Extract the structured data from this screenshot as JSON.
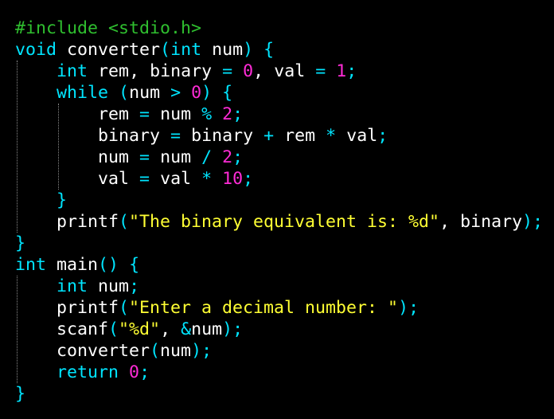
{
  "editor": {
    "colors": {
      "background": "#000000",
      "keyword": "#00e5ff",
      "type": "#00e5ff",
      "identifier": "#ffffff",
      "operator": "#00e5ff",
      "punctuation": "#ffffff",
      "number": "#ff2bd6",
      "string": "#ffff33",
      "preprocessor": "#2fbf2f",
      "indent_guide": "#8a8a8a"
    },
    "lines": [
      [
        {
          "t": "pre",
          "v": "#include <stdio.h>"
        }
      ],
      [
        {
          "t": "type",
          "v": "void"
        },
        {
          "t": "ws",
          "v": " "
        },
        {
          "t": "ident",
          "v": "converter"
        },
        {
          "t": "op",
          "v": "("
        },
        {
          "t": "type",
          "v": "int"
        },
        {
          "t": "ws",
          "v": " "
        },
        {
          "t": "ident",
          "v": "num"
        },
        {
          "t": "op",
          "v": ")"
        },
        {
          "t": "ws",
          "v": " "
        },
        {
          "t": "op",
          "v": "{"
        }
      ],
      [
        {
          "t": "ws",
          "v": "    "
        },
        {
          "t": "type",
          "v": "int"
        },
        {
          "t": "ws",
          "v": " "
        },
        {
          "t": "ident",
          "v": "rem"
        },
        {
          "t": "punct",
          "v": ","
        },
        {
          "t": "ws",
          "v": " "
        },
        {
          "t": "ident",
          "v": "binary"
        },
        {
          "t": "ws",
          "v": " "
        },
        {
          "t": "op",
          "v": "="
        },
        {
          "t": "ws",
          "v": " "
        },
        {
          "t": "number",
          "v": "0"
        },
        {
          "t": "punct",
          "v": ","
        },
        {
          "t": "ws",
          "v": " "
        },
        {
          "t": "ident",
          "v": "val"
        },
        {
          "t": "ws",
          "v": " "
        },
        {
          "t": "op",
          "v": "="
        },
        {
          "t": "ws",
          "v": " "
        },
        {
          "t": "number",
          "v": "1"
        },
        {
          "t": "op",
          "v": ";"
        }
      ],
      [
        {
          "t": "ws",
          "v": "    "
        },
        {
          "t": "keyword",
          "v": "while"
        },
        {
          "t": "ws",
          "v": " "
        },
        {
          "t": "op",
          "v": "("
        },
        {
          "t": "ident",
          "v": "num"
        },
        {
          "t": "ws",
          "v": " "
        },
        {
          "t": "op",
          "v": ">"
        },
        {
          "t": "ws",
          "v": " "
        },
        {
          "t": "number",
          "v": "0"
        },
        {
          "t": "op",
          "v": ")"
        },
        {
          "t": "ws",
          "v": " "
        },
        {
          "t": "op",
          "v": "{"
        }
      ],
      [
        {
          "t": "ws",
          "v": "        "
        },
        {
          "t": "ident",
          "v": "rem"
        },
        {
          "t": "ws",
          "v": " "
        },
        {
          "t": "op",
          "v": "="
        },
        {
          "t": "ws",
          "v": " "
        },
        {
          "t": "ident",
          "v": "num"
        },
        {
          "t": "ws",
          "v": " "
        },
        {
          "t": "op",
          "v": "%"
        },
        {
          "t": "ws",
          "v": " "
        },
        {
          "t": "number",
          "v": "2"
        },
        {
          "t": "op",
          "v": ";"
        }
      ],
      [
        {
          "t": "ws",
          "v": "        "
        },
        {
          "t": "ident",
          "v": "binary"
        },
        {
          "t": "ws",
          "v": " "
        },
        {
          "t": "op",
          "v": "="
        },
        {
          "t": "ws",
          "v": " "
        },
        {
          "t": "ident",
          "v": "binary"
        },
        {
          "t": "ws",
          "v": " "
        },
        {
          "t": "op",
          "v": "+"
        },
        {
          "t": "ws",
          "v": " "
        },
        {
          "t": "ident",
          "v": "rem"
        },
        {
          "t": "ws",
          "v": " "
        },
        {
          "t": "op",
          "v": "*"
        },
        {
          "t": "ws",
          "v": " "
        },
        {
          "t": "ident",
          "v": "val"
        },
        {
          "t": "op",
          "v": ";"
        }
      ],
      [
        {
          "t": "ws",
          "v": "        "
        },
        {
          "t": "ident",
          "v": "num"
        },
        {
          "t": "ws",
          "v": " "
        },
        {
          "t": "op",
          "v": "="
        },
        {
          "t": "ws",
          "v": " "
        },
        {
          "t": "ident",
          "v": "num"
        },
        {
          "t": "ws",
          "v": " "
        },
        {
          "t": "op",
          "v": "/"
        },
        {
          "t": "ws",
          "v": " "
        },
        {
          "t": "number",
          "v": "2"
        },
        {
          "t": "op",
          "v": ";"
        }
      ],
      [
        {
          "t": "ws",
          "v": "        "
        },
        {
          "t": "ident",
          "v": "val"
        },
        {
          "t": "ws",
          "v": " "
        },
        {
          "t": "op",
          "v": "="
        },
        {
          "t": "ws",
          "v": " "
        },
        {
          "t": "ident",
          "v": "val"
        },
        {
          "t": "ws",
          "v": " "
        },
        {
          "t": "op",
          "v": "*"
        },
        {
          "t": "ws",
          "v": " "
        },
        {
          "t": "number",
          "v": "10"
        },
        {
          "t": "op",
          "v": ";"
        }
      ],
      [
        {
          "t": "ws",
          "v": "    "
        },
        {
          "t": "op",
          "v": "}"
        }
      ],
      [
        {
          "t": "ws",
          "v": "    "
        },
        {
          "t": "ident",
          "v": "printf"
        },
        {
          "t": "op",
          "v": "("
        },
        {
          "t": "string",
          "v": "\"The binary equivalent is: %d\""
        },
        {
          "t": "punct",
          "v": ","
        },
        {
          "t": "ws",
          "v": " "
        },
        {
          "t": "ident",
          "v": "binary"
        },
        {
          "t": "op",
          "v": ")"
        },
        {
          "t": "op",
          "v": ";"
        }
      ],
      [
        {
          "t": "op",
          "v": "}"
        }
      ],
      [
        {
          "t": "type",
          "v": "int"
        },
        {
          "t": "ws",
          "v": " "
        },
        {
          "t": "ident",
          "v": "main"
        },
        {
          "t": "op",
          "v": "()"
        },
        {
          "t": "ws",
          "v": " "
        },
        {
          "t": "op",
          "v": "{"
        }
      ],
      [
        {
          "t": "ws",
          "v": "    "
        },
        {
          "t": "type",
          "v": "int"
        },
        {
          "t": "ws",
          "v": " "
        },
        {
          "t": "ident",
          "v": "num"
        },
        {
          "t": "op",
          "v": ";"
        }
      ],
      [
        {
          "t": "ws",
          "v": "    "
        },
        {
          "t": "ident",
          "v": "printf"
        },
        {
          "t": "op",
          "v": "("
        },
        {
          "t": "string",
          "v": "\"Enter a decimal number: \""
        },
        {
          "t": "op",
          "v": ")"
        },
        {
          "t": "op",
          "v": ";"
        }
      ],
      [
        {
          "t": "ws",
          "v": "    "
        },
        {
          "t": "ident",
          "v": "scanf"
        },
        {
          "t": "op",
          "v": "("
        },
        {
          "t": "string",
          "v": "\"%d\""
        },
        {
          "t": "punct",
          "v": ","
        },
        {
          "t": "ws",
          "v": " "
        },
        {
          "t": "op",
          "v": "&"
        },
        {
          "t": "ident",
          "v": "num"
        },
        {
          "t": "op",
          "v": ")"
        },
        {
          "t": "op",
          "v": ";"
        }
      ],
      [
        {
          "t": "ws",
          "v": "    "
        },
        {
          "t": "ident",
          "v": "converter"
        },
        {
          "t": "op",
          "v": "("
        },
        {
          "t": "ident",
          "v": "num"
        },
        {
          "t": "op",
          "v": ")"
        },
        {
          "t": "op",
          "v": ";"
        }
      ],
      [
        {
          "t": "ws",
          "v": "    "
        },
        {
          "t": "keyword",
          "v": "return"
        },
        {
          "t": "ws",
          "v": " "
        },
        {
          "t": "number",
          "v": "0"
        },
        {
          "t": "op",
          "v": ";"
        }
      ],
      [
        {
          "t": "op",
          "v": "}"
        }
      ]
    ]
  }
}
